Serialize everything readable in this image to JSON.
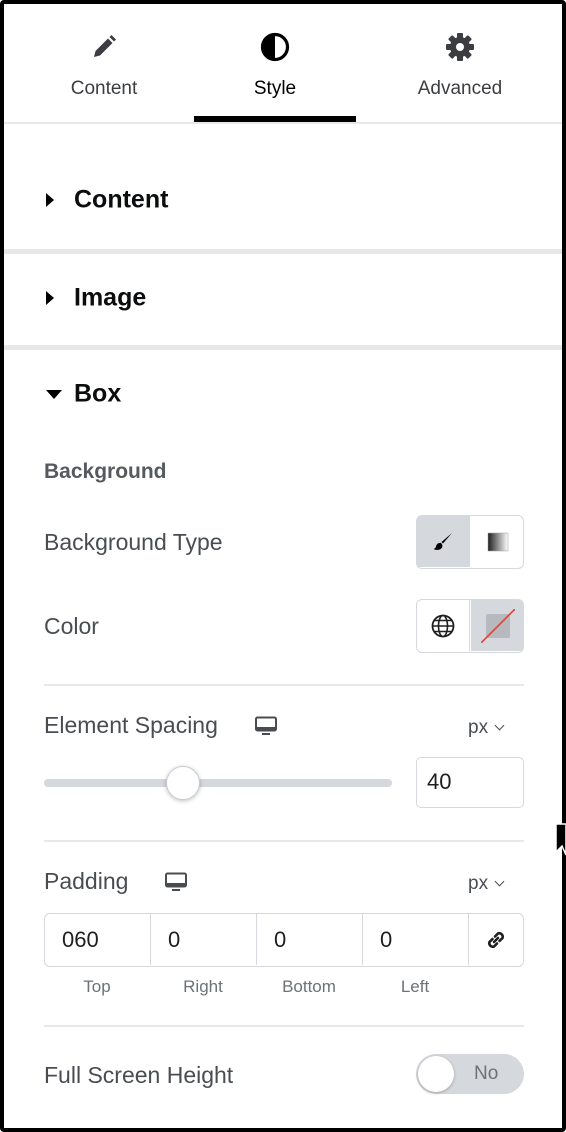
{
  "tabs": [
    {
      "label": "Content",
      "icon": "pencil-icon"
    },
    {
      "label": "Style",
      "icon": "contrast-circle-icon",
      "active": true
    },
    {
      "label": "Advanced",
      "icon": "gear-icon"
    }
  ],
  "sections": {
    "content": {
      "title": "Content",
      "expanded": false
    },
    "image": {
      "title": "Image",
      "expanded": false
    },
    "box": {
      "title": "Box",
      "expanded": true
    }
  },
  "box": {
    "background_heading": "Background",
    "background_type": {
      "label": "Background Type",
      "options": [
        "classic-brush-icon",
        "gradient-icon"
      ],
      "selected": "classic-brush-icon"
    },
    "color": {
      "label": "Color",
      "options": [
        "globe-icon",
        "color-swatch-none"
      ]
    },
    "element_spacing": {
      "label": "Element Spacing",
      "device_icon": "desktop-icon",
      "unit": "px",
      "value": "40",
      "slider_fraction": 0.4
    },
    "padding": {
      "label": "Padding",
      "device_icon": "desktop-icon",
      "unit": "px",
      "values": {
        "top": "060",
        "right": "0",
        "bottom": "0",
        "left": "0"
      },
      "labels": {
        "top": "Top",
        "right": "Right",
        "bottom": "Bottom",
        "left": "Left"
      },
      "link_icon": "link-icon"
    },
    "full_screen_height": {
      "label": "Full Screen Height",
      "toggle_text": "No",
      "enabled": false
    }
  },
  "colors": {
    "accent": "#000000",
    "border": "#d5d8dc",
    "selected_bg": "#d5d8dc",
    "separator": "#e6e8ea",
    "label_text": "#494d52",
    "swatch_strike": "#e0413b"
  }
}
